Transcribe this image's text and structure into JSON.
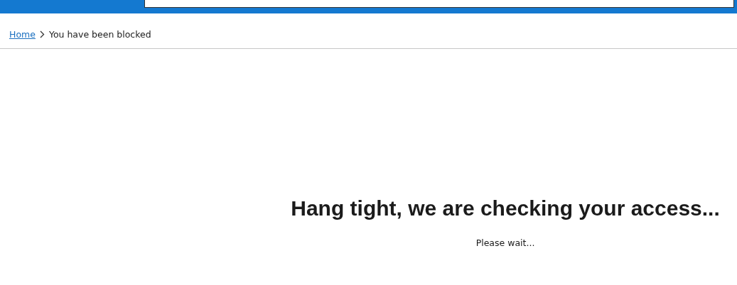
{
  "breadcrumb": [
    {
      "label": "Home",
      "kind": "link"
    },
    {
      "label": "You have been blocked",
      "kind": "current"
    }
  ],
  "heading": "Hang tight, we are checking your access...",
  "message": "Please wait..."
}
